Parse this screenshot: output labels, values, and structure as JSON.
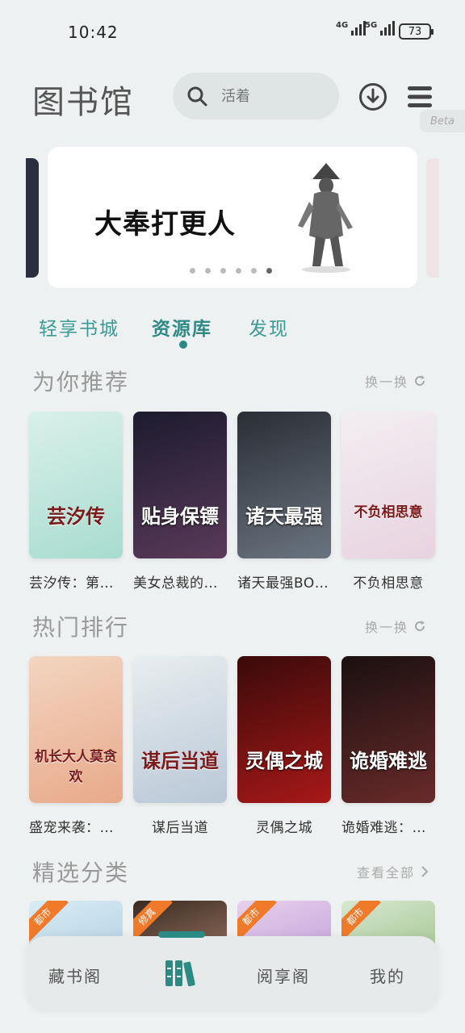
{
  "status": {
    "time": "10:42",
    "net1": "4G",
    "net2": "5G",
    "battery": "73"
  },
  "header": {
    "title": "图书馆",
    "search_placeholder": "活着",
    "beta_label": "Beta"
  },
  "banner": {
    "title": "大奉打更人",
    "dot_count": 6,
    "active_dot": 5
  },
  "tabs": [
    {
      "label": "轻享书城",
      "active": false
    },
    {
      "label": "资源库",
      "active": true
    },
    {
      "label": "发现",
      "active": false
    }
  ],
  "recommend": {
    "title": "为你推荐",
    "action": "换一换",
    "books": [
      {
        "title": "芸汐传：第一部",
        "cover_text": "芸汐传",
        "colors": [
          "#d9f0ea",
          "#a8dccf"
        ]
      },
      {
        "title": "美女总裁的贴身保镖",
        "cover_text": "贴身保镖",
        "colors": [
          "#1c1b2e",
          "#5a3a5a"
        ]
      },
      {
        "title": "诸天最强BOSS",
        "cover_text": "诸天最强",
        "colors": [
          "#2a2e35",
          "#6a7480"
        ]
      },
      {
        "title": "不负相思意",
        "cover_text": "不负相思意",
        "colors": [
          "#f3eef2",
          "#e8d3e0"
        ]
      }
    ]
  },
  "hot": {
    "title": "热门排行",
    "action": "换一换",
    "books": [
      {
        "title": "盛宠来袭：机长大人莫贪欢",
        "cover_text": "机长大人莫贪欢",
        "colors": [
          "#f3d5c0",
          "#e8a98a"
        ]
      },
      {
        "title": "谋后当道",
        "cover_text": "谋后当道",
        "colors": [
          "#e8eef0",
          "#b9c7d6"
        ]
      },
      {
        "title": "灵偶之城",
        "cover_text": "灵偶之城",
        "colors": [
          "#3a0a0a",
          "#a81818"
        ]
      },
      {
        "title": "诡婚难逃：阴阳鬼师",
        "cover_text": "诡婚难逃",
        "colors": [
          "#1a1010",
          "#6a2a2a"
        ]
      }
    ]
  },
  "category": {
    "title": "精选分类",
    "action": "查看全部",
    "cards": [
      {
        "tag": "都市",
        "colors": [
          "#d8ecf4",
          "#b9d4e6"
        ]
      },
      {
        "tag": "修真",
        "colors": [
          "#3a2a22",
          "#8a6a58"
        ]
      },
      {
        "tag": "都市",
        "colors": [
          "#e8d0ec",
          "#c8a8dc"
        ]
      },
      {
        "tag": "都市",
        "colors": [
          "#d8e8d0",
          "#a8c898"
        ]
      }
    ]
  },
  "bottom_nav": [
    {
      "label": "藏书阁"
    },
    {
      "label": ""
    },
    {
      "label": "阅享阁"
    },
    {
      "label": "我的"
    }
  ],
  "colors": {
    "accent": "#2a8a84",
    "background": "#eef1f1"
  }
}
